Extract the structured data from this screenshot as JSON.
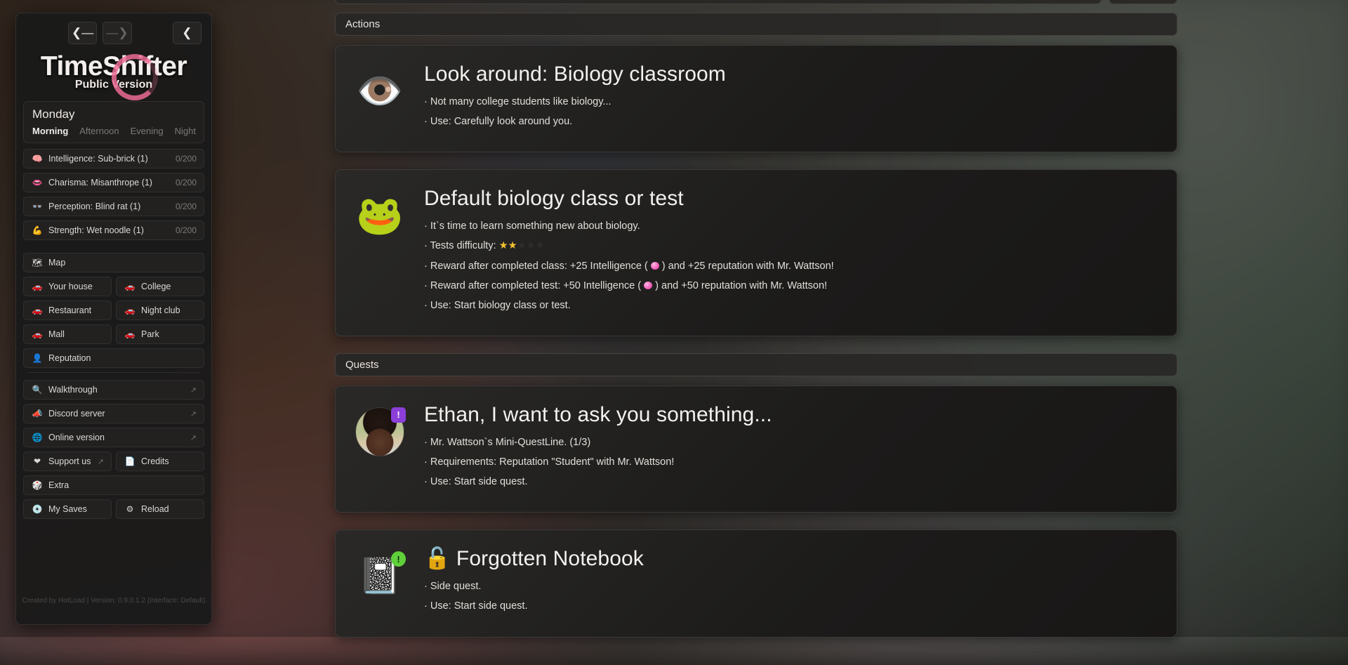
{
  "sidebar": {
    "nav": {
      "back_icon": "arrow-left",
      "forward_icon": "arrow-right",
      "collapse_icon": "chevron-left"
    },
    "brand": {
      "title": "TimeShifter",
      "subtitle": "Public Version"
    },
    "day": "Monday",
    "times_of_day": [
      "Morning",
      "Afternoon",
      "Evening",
      "Night"
    ],
    "active_time_of_day": "Morning",
    "stats": [
      {
        "icon": "brain-icon",
        "label": "Intelligence: Sub-brick (1)",
        "value": "0/200"
      },
      {
        "icon": "lips-icon",
        "label": "Charisma: Misanthrope (1)",
        "value": "0/200"
      },
      {
        "icon": "eyes-icon",
        "label": "Perception: Blind rat (1)",
        "value": "0/200"
      },
      {
        "icon": "muscle-icon",
        "label": "Strength: Wet noodle (1)",
        "value": "0/200"
      }
    ],
    "map": {
      "header": {
        "icon": "map-icon",
        "label": "Map"
      },
      "places": [
        {
          "icon": "car-icon",
          "label": "Your house"
        },
        {
          "icon": "car-icon",
          "label": "College"
        },
        {
          "icon": "car-icon",
          "label": "Restaurant"
        },
        {
          "icon": "car-icon",
          "label": "Night club"
        },
        {
          "icon": "car-icon",
          "label": "Mall"
        },
        {
          "icon": "car-icon",
          "label": "Park"
        }
      ],
      "reputation": {
        "icon": "person-icon",
        "label": "Reputation"
      }
    },
    "links": [
      {
        "icon": "magnifier-icon",
        "label": "Walkthrough",
        "external": "↗"
      },
      {
        "icon": "discord-icon",
        "label": "Discord server",
        "external": "↗"
      },
      {
        "icon": "globe-icon",
        "label": "Online version",
        "external": "↗"
      }
    ],
    "support": {
      "icon": "heart-icon",
      "label": "Support us",
      "external": "↗"
    },
    "credits": {
      "icon": "page-icon",
      "label": "Credits"
    },
    "extra": {
      "icon": "dice-icon",
      "label": "Extra"
    },
    "saves": {
      "icon": "disc-icon",
      "label": "My Saves"
    },
    "reload": {
      "icon": "gear-icon",
      "label": "Reload"
    },
    "footer": "Created by HotLoad | Version: 0.9.0.1.2 (Interface: Default)"
  },
  "main": {
    "actions_header": "Actions",
    "quests_header": "Quests",
    "actions": [
      {
        "icon": "eye-icon",
        "badge": null,
        "title": "Look around: Biology classroom",
        "lines": [
          "· Not many college students like biology...",
          "· Use: Carefully look around you."
        ]
      },
      {
        "icon": "frog-icon",
        "badge": null,
        "title": "Default biology class or test",
        "lines": [
          "· It`s time to learn something new about biology.",
          "· Tests difficulty: __STARS__",
          "· Reward after completed class: +25 Intelligence ( __DOT__ ) and +25 reputation with Mr. Wattson!",
          "· Reward after completed test: +50 Intelligence ( __DOT__ ) and +50 reputation with Mr. Wattson!",
          "· Use: Start biology class or test."
        ],
        "difficulty": {
          "filled": 2,
          "total": 5
        }
      }
    ],
    "quests": [
      {
        "icon": "avatar",
        "badge": {
          "text": "!",
          "color": "#8b3ed8"
        },
        "title": "Ethan, I want to ask you something...",
        "lines": [
          "· Mr. Wattson`s Mini-QuestLine. (1/3)",
          "· Requirements: Reputation \"Student\" with Mr. Wattson!",
          "· Use: Start side quest."
        ]
      },
      {
        "icon": "notebook-icon",
        "badge": {
          "text": "!",
          "color": "#5fcf3a"
        },
        "title_prefix_icon": "unlocked-padlock-icon",
        "title": "Forgotten Notebook",
        "lines": [
          "· Side quest.",
          "· Use: Start side quest."
        ]
      }
    ]
  }
}
